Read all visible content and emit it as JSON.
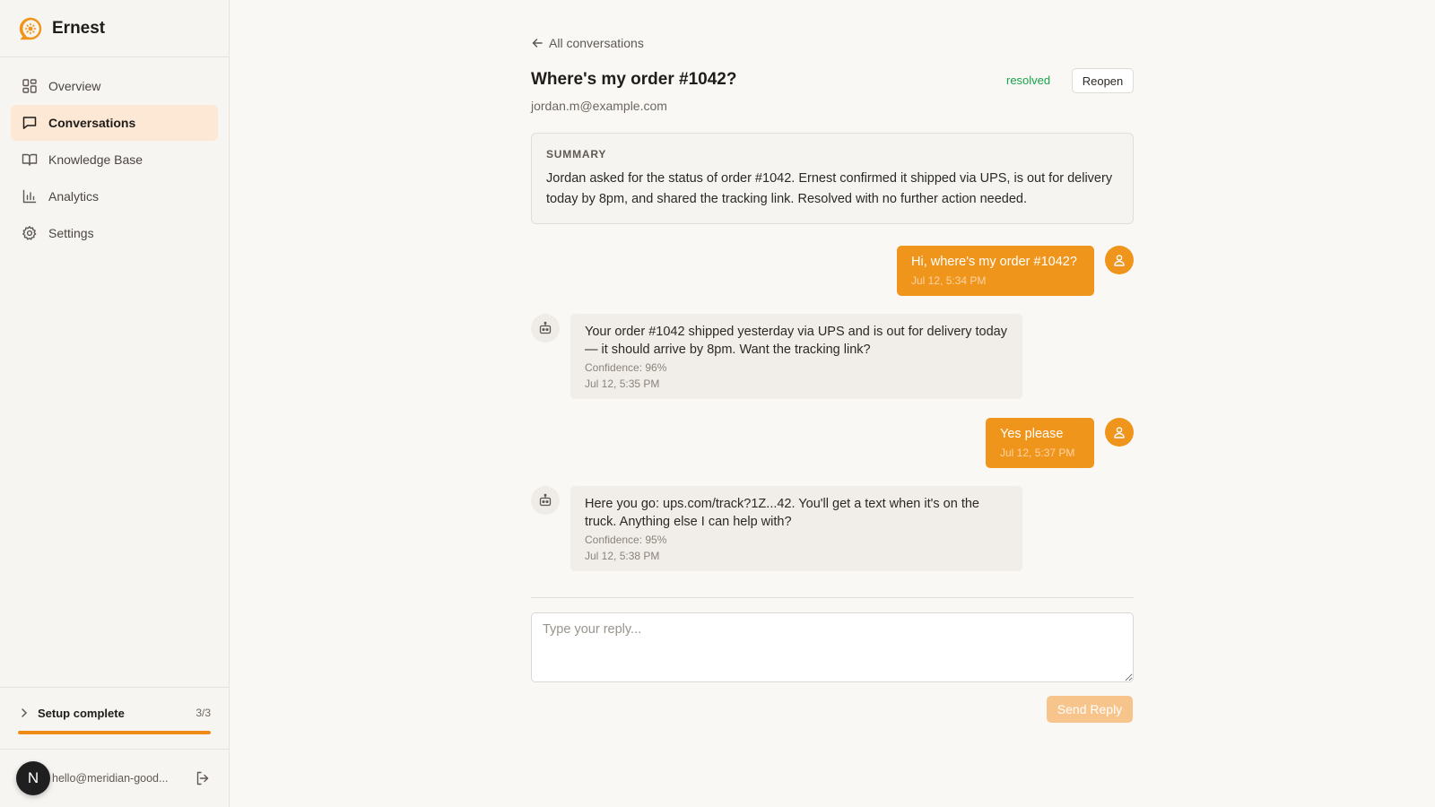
{
  "app": {
    "name": "Ernest"
  },
  "sidebar": {
    "items": [
      {
        "label": "Overview",
        "icon": "grid-icon",
        "active": false
      },
      {
        "label": "Conversations",
        "icon": "chat-icon",
        "active": true
      },
      {
        "label": "Knowledge Base",
        "icon": "book-icon",
        "active": false
      },
      {
        "label": "Analytics",
        "icon": "bar-chart-icon",
        "active": false
      },
      {
        "label": "Settings",
        "icon": "gear-icon",
        "active": false
      }
    ],
    "setup": {
      "label": "Setup complete",
      "count": "3/3",
      "progress": 1.0
    },
    "user": {
      "initial": "N",
      "email": "hello@meridian-good..."
    }
  },
  "conversation": {
    "back_label": "All conversations",
    "title": "Where's my order #1042?",
    "email": "jordan.m@example.com",
    "status": "resolved",
    "reopen_label": "Reopen",
    "summary": {
      "heading": "SUMMARY",
      "text": "Jordan asked for the status of order #1042. Ernest confirmed it shipped via UPS, is out for delivery today by 8pm, and shared the tracking link. Resolved with no further action needed."
    },
    "messages": [
      {
        "role": "user",
        "text": "Hi, where's my order #1042?",
        "time": "Jul 12, 5:34 PM"
      },
      {
        "role": "bot",
        "text": "Your order #1042 shipped yesterday via UPS and is out for delivery today — it should arrive by 8pm. Want the tracking link?",
        "confidence": "Confidence: 96%",
        "time": "Jul 12, 5:35 PM"
      },
      {
        "role": "user",
        "text": "Yes please",
        "time": "Jul 12, 5:37 PM"
      },
      {
        "role": "bot",
        "text": "Here you go: ups.com/track?1Z...42. You'll get a text when it's on the truck. Anything else I can help with?",
        "confidence": "Confidence: 95%",
        "time": "Jul 12, 5:38 PM"
      }
    ],
    "reply": {
      "placeholder": "Type your reply...",
      "value": ""
    },
    "send_label": "Send Reply"
  },
  "colors": {
    "accent": "#f0951c",
    "active_bg": "#fde8d5",
    "resolved": "#16a34a"
  }
}
